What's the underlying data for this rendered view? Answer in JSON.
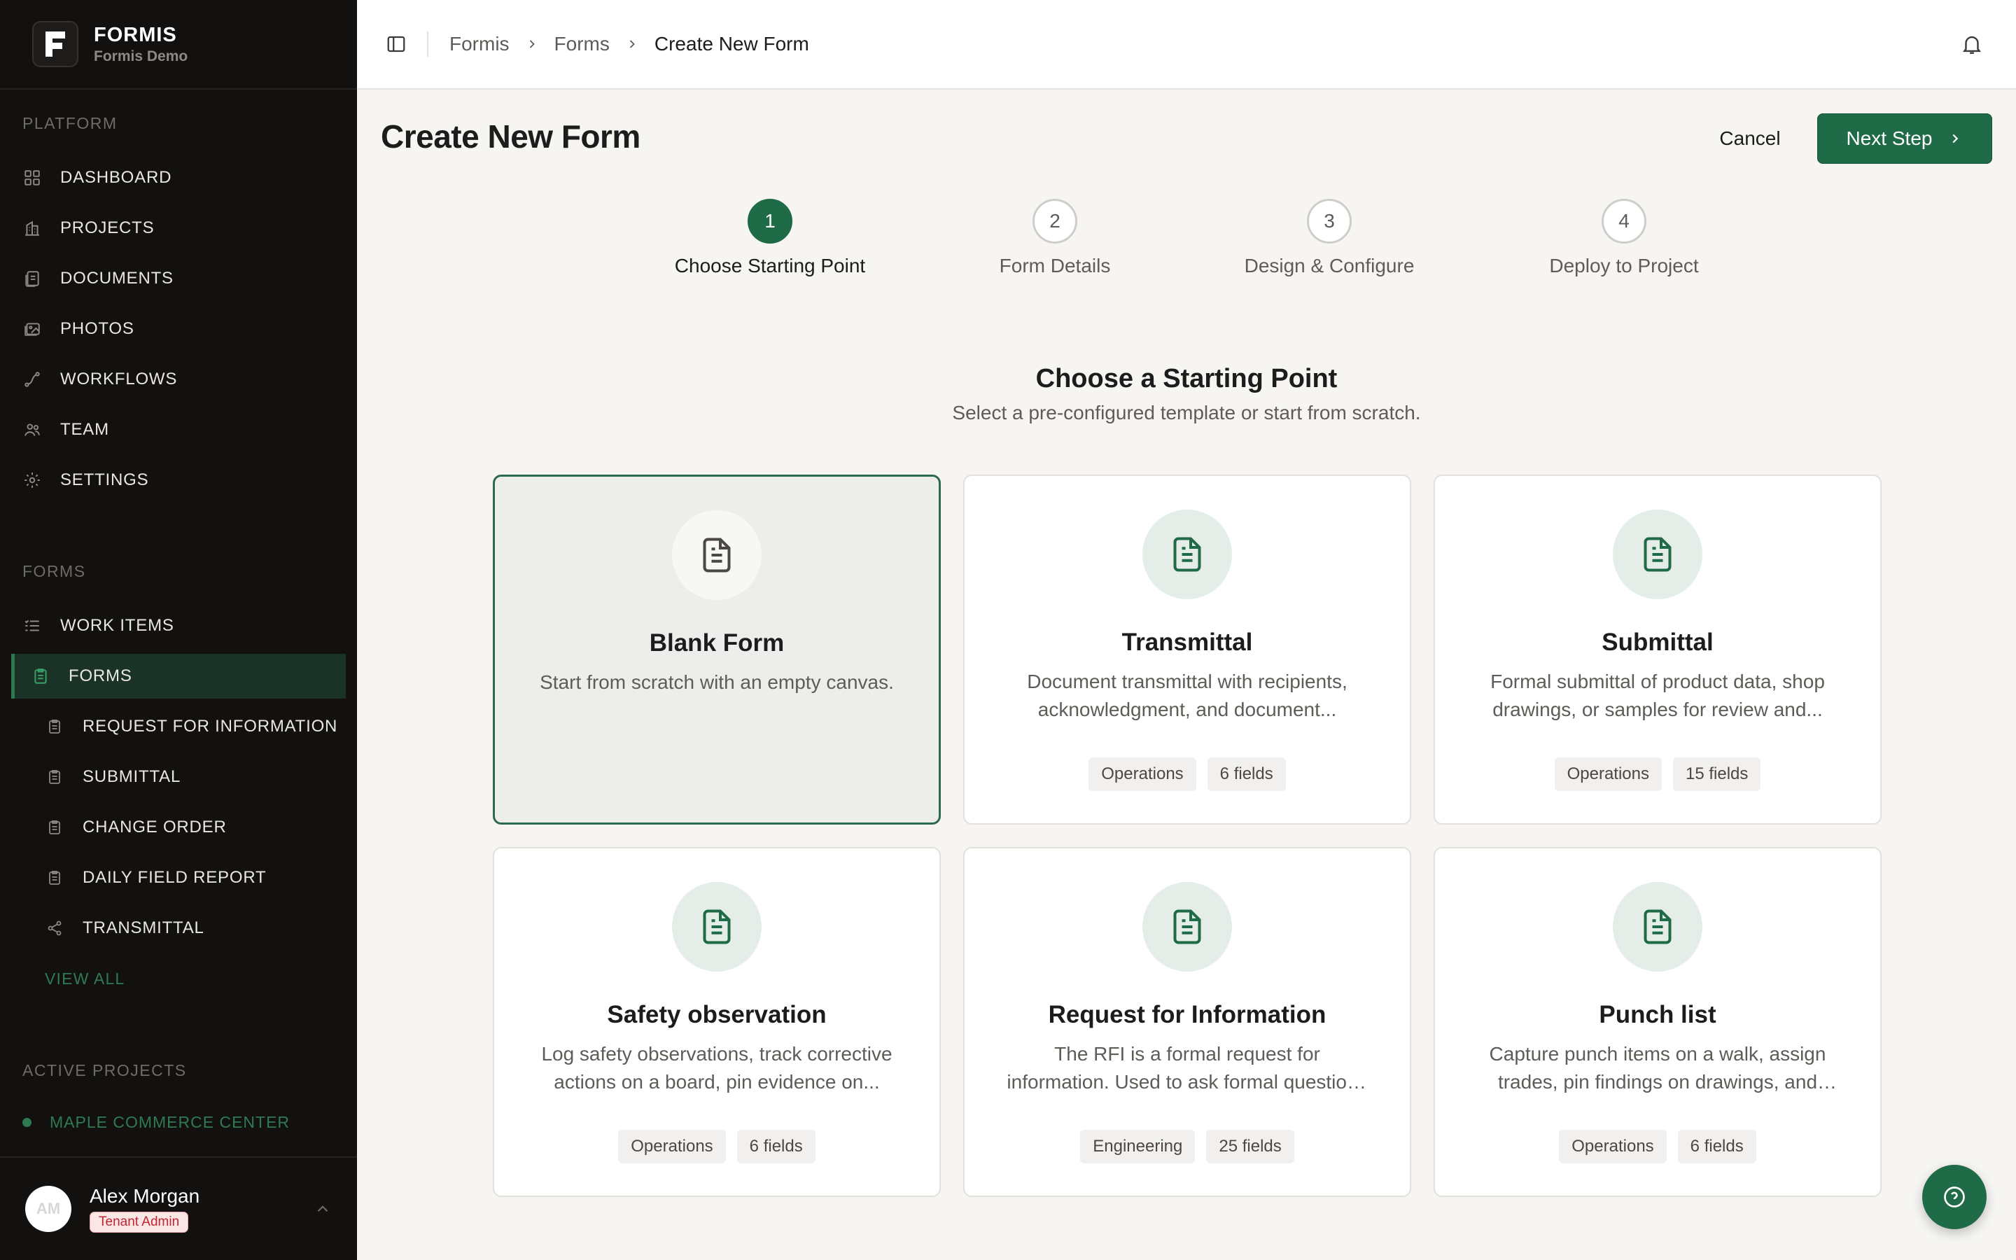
{
  "brand": {
    "name": "FORMIS",
    "subtitle": "Formis Demo"
  },
  "sidebar": {
    "platform_label": "PLATFORM",
    "platform_items": [
      {
        "label": "DASHBOARD",
        "icon": "grid-icon"
      },
      {
        "label": "PROJECTS",
        "icon": "building-icon"
      },
      {
        "label": "DOCUMENTS",
        "icon": "documents-icon"
      },
      {
        "label": "PHOTOS",
        "icon": "photos-icon"
      },
      {
        "label": "WORKFLOWS",
        "icon": "workflow-icon"
      },
      {
        "label": "TEAM",
        "icon": "team-icon"
      },
      {
        "label": "SETTINGS",
        "icon": "gear-icon"
      }
    ],
    "forms_label": "FORMS",
    "forms_items": [
      {
        "label": "WORK ITEMS",
        "icon": "list-icon"
      },
      {
        "label": "FORMS",
        "icon": "clipboard-icon",
        "active": true
      },
      {
        "label": "REQUEST FOR INFORMATION",
        "icon": "clipboard-icon"
      },
      {
        "label": "SUBMITTAL",
        "icon": "clipboard-icon"
      },
      {
        "label": "CHANGE ORDER",
        "icon": "clipboard-icon"
      },
      {
        "label": "DAILY FIELD REPORT",
        "icon": "clipboard-icon"
      },
      {
        "label": "TRANSMITTAL",
        "icon": "share-icon"
      }
    ],
    "view_all": "VIEW ALL",
    "active_projects_label": "ACTIVE PROJECTS",
    "active_projects": [
      {
        "label": "MAPLE COMMERCE CENTER"
      }
    ]
  },
  "user": {
    "initials": "AM",
    "name": "Alex Morgan",
    "role": "Tenant Admin"
  },
  "breadcrumb": [
    "Formis",
    "Forms",
    "Create New Form"
  ],
  "page": {
    "title": "Create New Form",
    "cancel_label": "Cancel",
    "next_label": "Next Step"
  },
  "steps": [
    {
      "number": "1",
      "label": "Choose Starting Point",
      "active": true
    },
    {
      "number": "2",
      "label": "Form Details"
    },
    {
      "number": "3",
      "label": "Design & Configure"
    },
    {
      "number": "4",
      "label": "Deploy to Project"
    }
  ],
  "section": {
    "title": "Choose a Starting Point",
    "subtitle": "Select a pre-configured template or start from scratch."
  },
  "templates": [
    {
      "title": "Blank Form",
      "description": "Start from scratch with an empty canvas.",
      "selected": true,
      "tags": []
    },
    {
      "title": "Transmittal",
      "description": "Document transmittal with recipients, acknowledgment, and document...",
      "tags": [
        "Operations",
        "6 fields"
      ]
    },
    {
      "title": "Submittal",
      "description": "Formal submittal of product data, shop drawings, or samples for review and...",
      "tags": [
        "Operations",
        "15 fields"
      ]
    },
    {
      "title": "Safety observation",
      "description": "Log safety observations, track corrective actions on a board, pin evidence on...",
      "tags": [
        "Operations",
        "6 fields"
      ]
    },
    {
      "title": "Request for Information",
      "description": "The RFI is a formal request for information. Used to ask formal questions about the...",
      "tags": [
        "Engineering",
        "25 fields"
      ]
    },
    {
      "title": "Punch list",
      "description": "Capture punch items on a walk, assign trades, pin findings on drawings, and clos...",
      "tags": [
        "Operations",
        "6 fields"
      ]
    }
  ],
  "colors": {
    "sidebar_bg": "#121110",
    "accent": "#1f6b47",
    "page_bg": "#f6f5f2",
    "badge_red": "#c0262f"
  }
}
